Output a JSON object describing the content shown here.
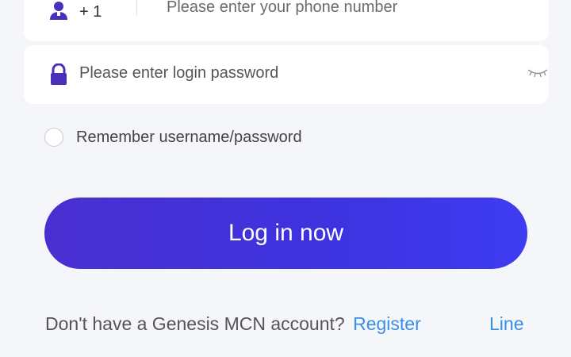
{
  "phone": {
    "country_code": "+ 1",
    "placeholder": "Please enter your phone number"
  },
  "password": {
    "placeholder": "Please enter login password"
  },
  "remember": {
    "label": "Remember username/password",
    "checked": false
  },
  "login_button": {
    "label": "Log in now"
  },
  "footer": {
    "prompt": "Don't have a Genesis MCN account?",
    "register_label": "Register",
    "line_label": "Line"
  },
  "colors": {
    "accent": "#4434dd",
    "link": "#3a8ee6",
    "icon": "#4a2fb8",
    "background": "#f4f6f9"
  },
  "icons": {
    "phone_field": "user-icon",
    "password_field": "lock-icon",
    "toggle_visibility": "eye-closed-icon"
  }
}
